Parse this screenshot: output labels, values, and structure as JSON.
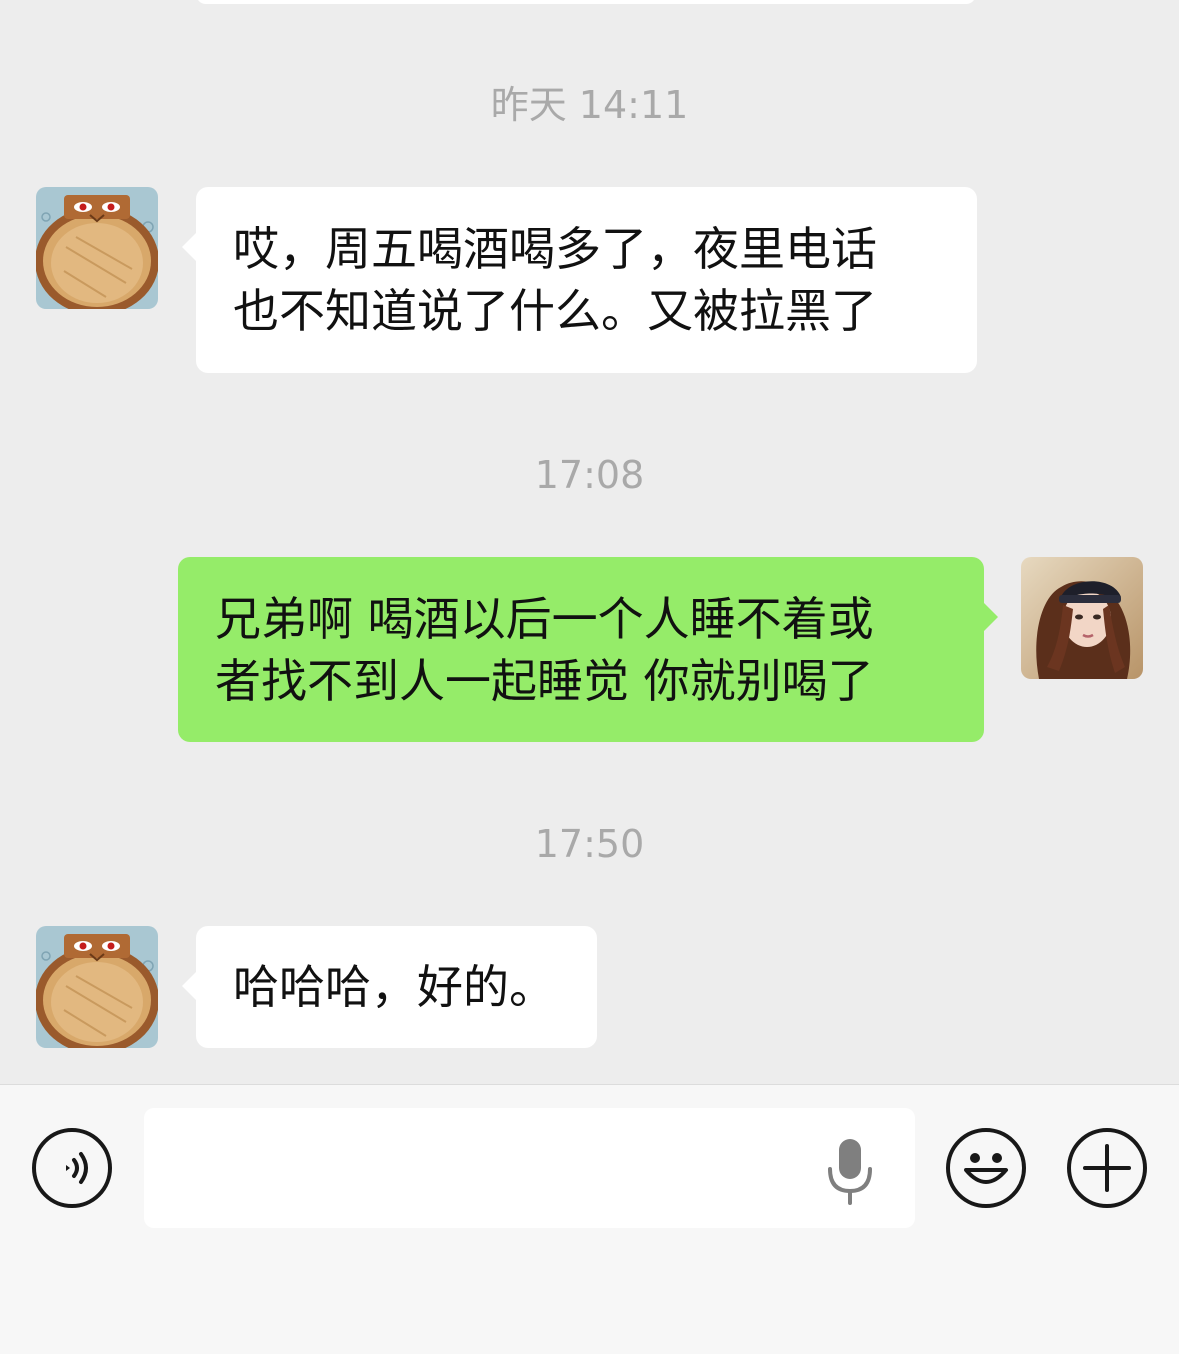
{
  "conversation": {
    "messages": [
      {
        "time": "昨天 14:11",
        "side": "left",
        "lines": [
          "哎，周五喝酒喝多了，夜里电话",
          "也不知道说了什么。又被拉黑了"
        ]
      },
      {
        "time": "17:08",
        "side": "right",
        "lines": [
          "兄弟啊 喝酒以后一个人睡不着或",
          "者找不到人一起睡觉 你就别喝了"
        ]
      },
      {
        "time": "17:50",
        "side": "left",
        "lines": [
          "哈哈哈，好的。"
        ]
      }
    ]
  },
  "input_bar": {
    "text_value": "",
    "icons": {
      "voice": "voice-toggle-icon",
      "mic": "microphone-icon",
      "emoji": "emoji-smile-icon",
      "plus": "plus-icon"
    }
  },
  "colors": {
    "background": "#ededed",
    "left_bubble": "#ffffff",
    "right_bubble": "#95ec69",
    "timestamp": "#a9a9a9",
    "input_bar": "#f7f7f7"
  }
}
